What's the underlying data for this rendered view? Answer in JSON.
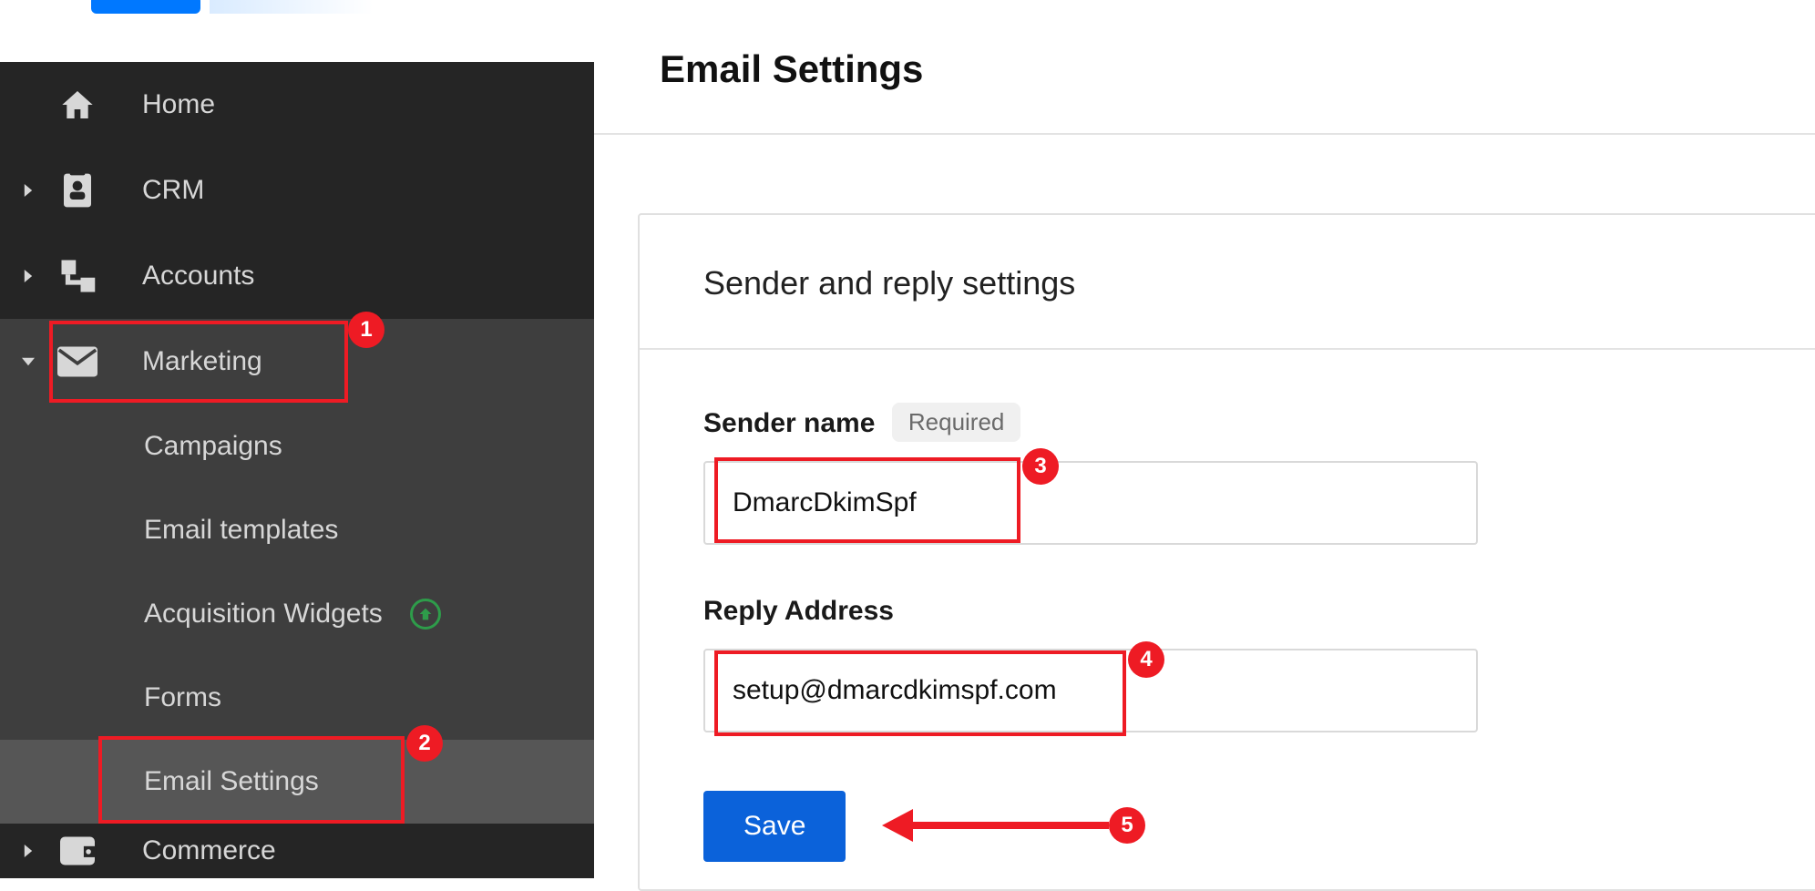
{
  "sidebar": {
    "items": [
      {
        "label": "Home"
      },
      {
        "label": "CRM"
      },
      {
        "label": "Accounts"
      },
      {
        "label": "Marketing"
      },
      {
        "label": "Commerce"
      }
    ],
    "marketing_children": [
      {
        "label": "Campaigns"
      },
      {
        "label": "Email templates"
      },
      {
        "label": "Acquisition Widgets"
      },
      {
        "label": "Forms"
      },
      {
        "label": "Email Settings"
      }
    ]
  },
  "page": {
    "title": "Email Settings",
    "card_title": "Sender and reply settings",
    "sender_label": "Sender name",
    "sender_required": "Required",
    "sender_value": "DmarcDkimSpf",
    "reply_label": "Reply Address",
    "reply_value": "setup@dmarcdkimspf.com",
    "save_label": "Save"
  },
  "annotations": {
    "b1": "1",
    "b2": "2",
    "b3": "3",
    "b4": "4",
    "b5": "5"
  }
}
